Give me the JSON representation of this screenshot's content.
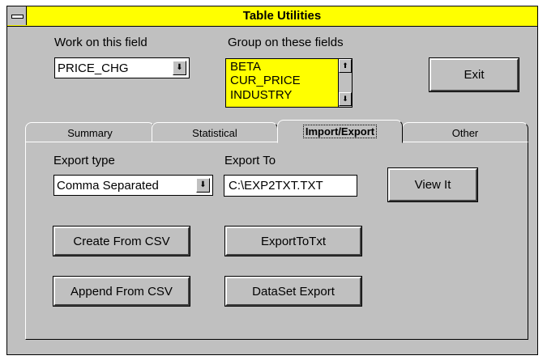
{
  "window": {
    "title": "Table Utilities"
  },
  "work_field": {
    "label": "Work on this field",
    "value": "PRICE_CHG"
  },
  "group_fields": {
    "label": "Group on these fields",
    "items": [
      "BETA",
      "CUR_PRICE",
      "INDUSTRY"
    ]
  },
  "exit_label": "Exit",
  "tabs": [
    "Summary",
    "Statistical",
    "Import/Export",
    "Other"
  ],
  "active_tab": "Import/Export",
  "export_type": {
    "label": "Export type",
    "value": "Comma Separated"
  },
  "export_to": {
    "label": "Export To",
    "value": "C:\\EXP2TXT.TXT"
  },
  "buttons": {
    "view_it": "View It",
    "create_from_csv": "Create From CSV",
    "export_to_txt": "ExportToTxt",
    "append_from_csv": "Append From CSV",
    "dataset_export": "DataSet Export"
  },
  "icons": {
    "dropdown": "down-arrow-icon",
    "scroll_up": "scroll-up-icon",
    "scroll_down": "scroll-down-icon",
    "system_menu": "system-menu-icon"
  },
  "colors": {
    "title_bar": "#ffff00",
    "listbox_bg": "#ffff00",
    "window_bg": "#c0c0c0"
  }
}
